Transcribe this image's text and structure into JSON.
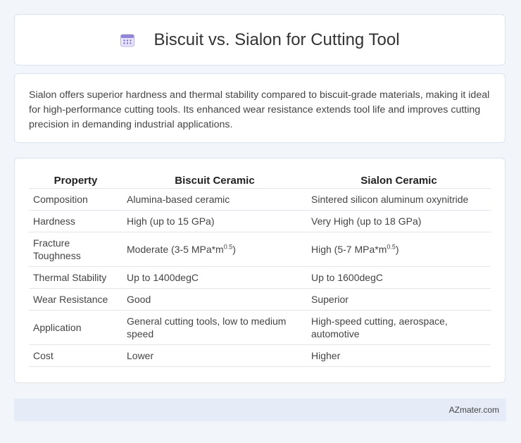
{
  "header": {
    "title": "Biscuit vs. Sialon for Cutting Tool",
    "icon": "calendar-icon"
  },
  "summary": {
    "text": "Sialon offers superior hardness and thermal stability compared to biscuit-grade materials, making it ideal for high-performance cutting tools. Its enhanced wear resistance extends tool life and improves cutting precision in demanding industrial applications."
  },
  "table": {
    "headers": [
      "Property",
      "Biscuit Ceramic",
      "Sialon Ceramic"
    ],
    "rows": [
      {
        "property": "Composition",
        "biscuit": "Alumina-based ceramic",
        "sialon": "Sintered silicon aluminum oxynitride"
      },
      {
        "property": "Hardness",
        "biscuit": "High (up to 15 GPa)",
        "sialon": "Very High (up to 18 GPa)"
      },
      {
        "property": "Fracture Toughness",
        "biscuit_pre": "Moderate (3-5 MPa*m",
        "biscuit_exp": "0.5",
        "biscuit_post": ")",
        "sialon_pre": "High (5-7 MPa*m",
        "sialon_exp": "0.5",
        "sialon_post": ")"
      },
      {
        "property": "Thermal Stability",
        "biscuit": "Up to 1400degC",
        "sialon": "Up to 1600degC"
      },
      {
        "property": "Wear Resistance",
        "biscuit": "Good",
        "sialon": "Superior"
      },
      {
        "property": "Application",
        "biscuit": "General cutting tools, low to medium speed",
        "sialon": "High-speed cutting, aerospace, automotive"
      },
      {
        "property": "Cost",
        "biscuit": "Lower",
        "sialon": "Higher"
      }
    ]
  },
  "footer": {
    "brand": "AZmater.com"
  },
  "colors": {
    "background": "#f2f5fa",
    "footer_bg": "#e6ecf7",
    "icon_accent": "#7b6fd6"
  }
}
